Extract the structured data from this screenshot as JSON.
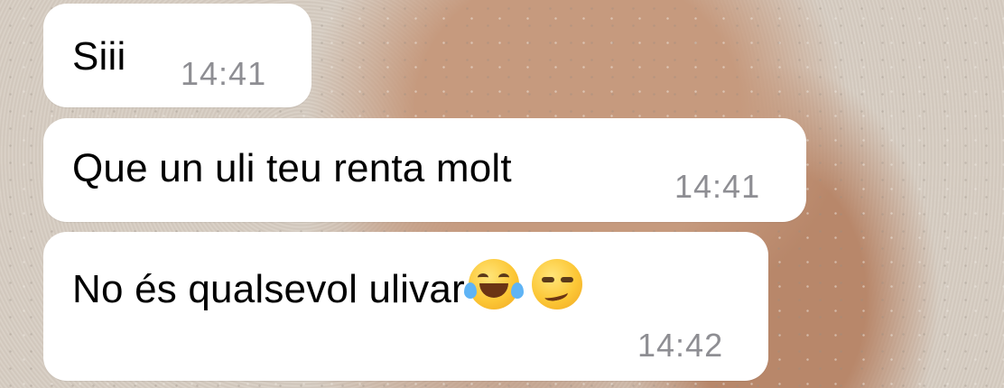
{
  "messages": [
    {
      "text": "Siii",
      "time": "14:41"
    },
    {
      "text": "Que un uli teu renta molt",
      "time": "14:41"
    },
    {
      "text": "No és qualsevol ulivar",
      "time": "14:42",
      "emojis": [
        "face-with-tears-of-joy",
        "smirking-face"
      ]
    }
  ],
  "colors": {
    "bubble": "#ffffff",
    "text": "#000000",
    "timestamp": "#8e8e93"
  }
}
